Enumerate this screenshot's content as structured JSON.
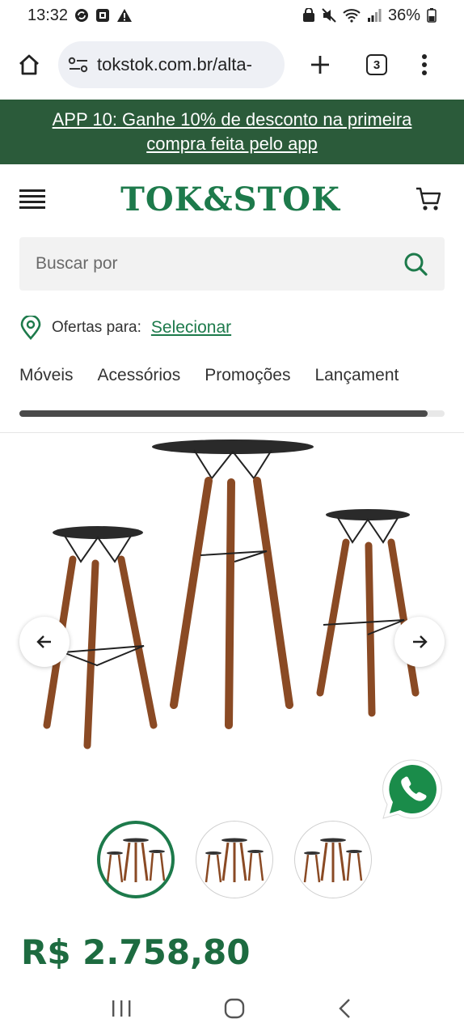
{
  "status_bar": {
    "time": "13:32",
    "battery": "36%"
  },
  "browser": {
    "url": "tokstok.com.br/alta-",
    "tab_count": "3"
  },
  "promo": {
    "text": "APP 10: Ganhe 10% de desconto na primeira compra feita pelo app"
  },
  "header": {
    "logo": "TOK&STOK"
  },
  "search": {
    "placeholder": "Buscar por"
  },
  "location": {
    "label": "Ofertas para:",
    "link": "Selecionar"
  },
  "categories": [
    {
      "label": "Móveis"
    },
    {
      "label": "Acessórios"
    },
    {
      "label": "Promoções"
    },
    {
      "label": "Lançament"
    }
  ],
  "category_scroll_progress": 0.96,
  "product": {
    "price": "R$ 2.758,80",
    "thumbnail_count": 3,
    "active_thumbnail": 0
  },
  "colors": {
    "brand_green": "#1d7a4b",
    "banner_green": "#2b5b3a",
    "whatsapp_green": "#1a8c4a"
  },
  "icons": {
    "status_left": [
      "sync-icon",
      "screenshot-icon",
      "warning-icon"
    ],
    "status_right": [
      "lock-icon",
      "mute-icon",
      "wifi-icon",
      "signal-icon",
      "battery-icon"
    ]
  }
}
